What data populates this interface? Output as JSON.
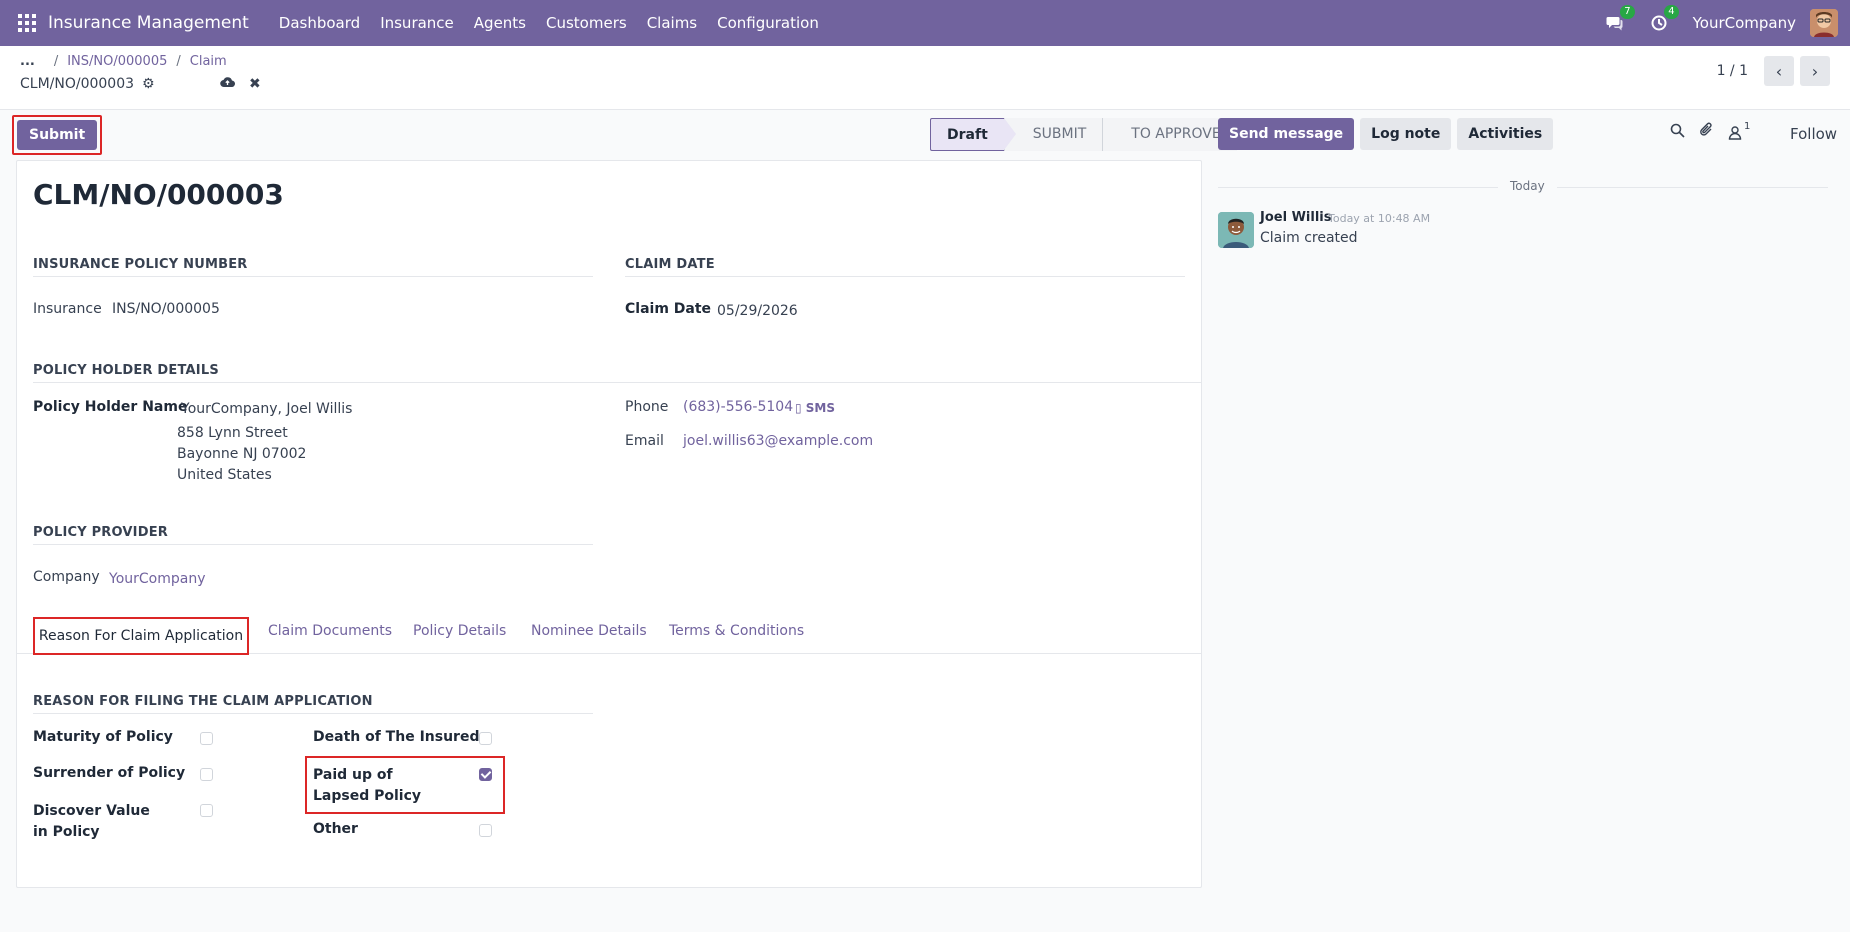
{
  "navbar": {
    "brand": "Insurance Management",
    "menu": [
      "Dashboard",
      "Insurance",
      "Agents",
      "Customers",
      "Claims",
      "Configuration"
    ],
    "messages_count": "7",
    "activities_count": "4",
    "company": "YourCompany"
  },
  "breadcrumb": {
    "dots": "...",
    "items": [
      "INS/NO/000005",
      "Claim"
    ],
    "record": "CLM/NO/000003"
  },
  "pager": {
    "text": "1 / 1"
  },
  "statusbar": {
    "submit_label": "Submit",
    "stages": [
      "Draft",
      "SUBMIT",
      "TO APPROVE"
    ],
    "active_stage": "Draft"
  },
  "chatter_buttons": {
    "send_message": "Send message",
    "log_note": "Log note",
    "activities": "Activities",
    "followers_count": "1",
    "follow": "Follow"
  },
  "form": {
    "title": "CLM/NO/000003",
    "sections": {
      "policy_number": "INSURANCE POLICY NUMBER",
      "claim_date": "CLAIM DATE",
      "holder": "POLICY HOLDER DETAILS",
      "provider": "POLICY PROVIDER",
      "reason": "REASON FOR FILING THE CLAIM APPLICATION"
    },
    "insurance_label": "Insurance",
    "insurance_value": "INS/NO/000005",
    "claim_date_label": "Claim Date",
    "claim_date_value": "05/29/2026",
    "holder_label": "Policy Holder Name",
    "holder_name": "YourCompany, Joel Willis",
    "address": [
      "858 Lynn Street",
      "Bayonne NJ 07002",
      "United States"
    ],
    "phone_label": "Phone",
    "phone_value": "(683)-556-5104",
    "sms_label": "SMS",
    "email_label": "Email",
    "email_value": "joel.willis63@example.com",
    "company_label": "Company",
    "company_value": "YourCompany",
    "tabs": [
      "Reason For Claim Application",
      "Claim Documents",
      "Policy Details",
      "Nominee Details",
      "Terms & Conditions"
    ],
    "reasons_left": [
      {
        "label": "Maturity of Policy",
        "checked": false
      },
      {
        "label": "Surrender of Policy",
        "checked": false
      },
      {
        "label": "Discover Value in Policy",
        "checked": false
      }
    ],
    "reasons_right": [
      {
        "label": "Death of The Insured",
        "checked": false
      },
      {
        "label": "Paid up of Lapsed Policy",
        "checked": true
      },
      {
        "label": "Other",
        "checked": false
      }
    ]
  },
  "chatter": {
    "date_separator": "Today",
    "message": {
      "author": "Joel Willis",
      "time": "Today at 10:48 AM",
      "body": "Claim created"
    }
  },
  "colors": {
    "brand": "#71639e",
    "highlight": "#dc2626"
  }
}
